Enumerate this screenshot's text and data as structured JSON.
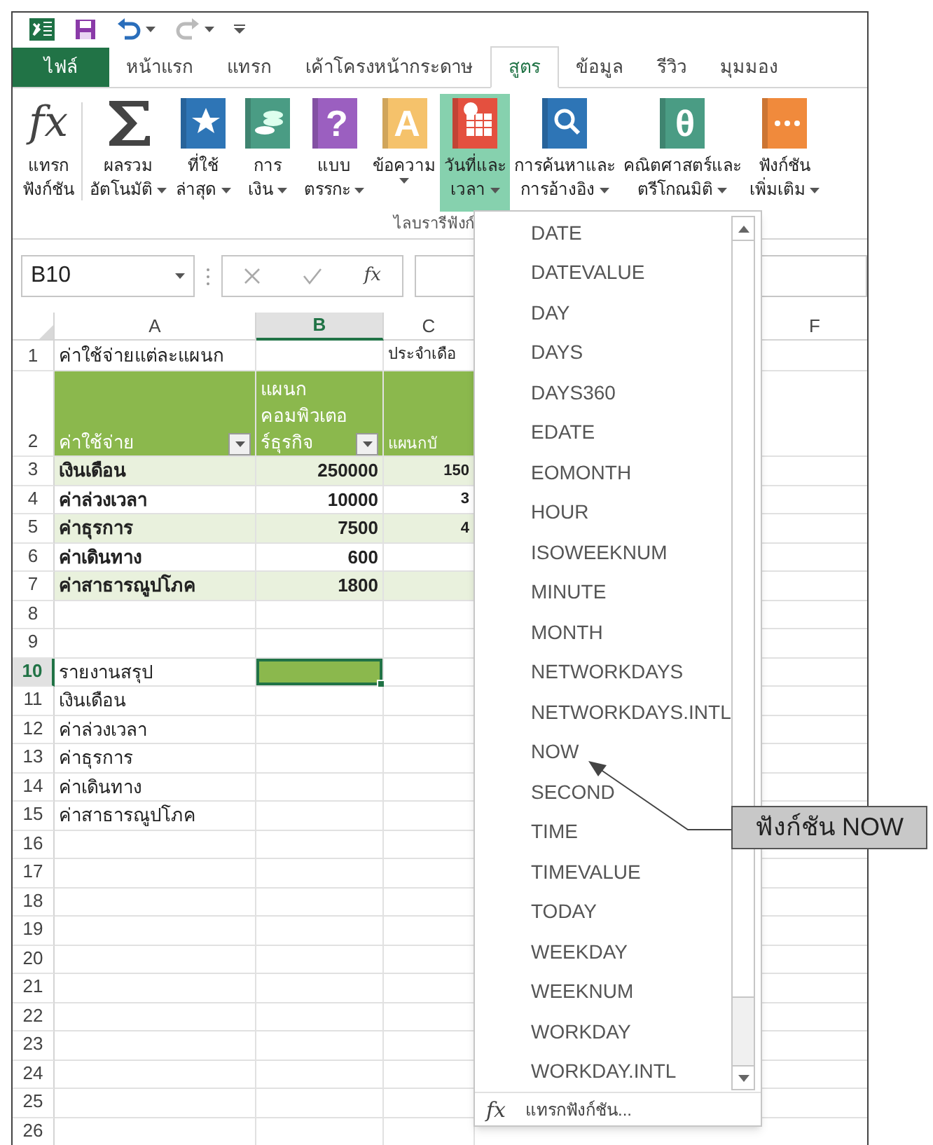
{
  "quick_access": [
    {
      "kind": "excel"
    },
    {
      "kind": "save"
    },
    {
      "kind": "undo"
    },
    {
      "kind": "redo"
    },
    {
      "kind": "customize"
    }
  ],
  "tabs": [
    {
      "label": "ไฟล์",
      "kind": "file",
      "selected": false
    },
    {
      "label": "หน้าแรก",
      "kind": "tab",
      "selected": false
    },
    {
      "label": "แทรก",
      "kind": "tab",
      "selected": false
    },
    {
      "label": "เค้าโครงหน้ากระดาษ",
      "kind": "tab",
      "selected": false
    },
    {
      "label": "สูตร",
      "kind": "tab",
      "selected": true
    },
    {
      "label": "ข้อมูล",
      "kind": "tab",
      "selected": false
    },
    {
      "label": "รีวิว",
      "kind": "tab",
      "selected": false
    },
    {
      "label": "มุมมอง",
      "kind": "tab",
      "selected": false
    }
  ],
  "ribbon": {
    "buttons": [
      {
        "kind": "fx",
        "glyph": "fx",
        "line1": "แทรก",
        "line2": "ฟังก์ชัน",
        "caret": false,
        "selected": false
      },
      {
        "kind": "sum",
        "line1": "ผลรวม",
        "line2": "อัตโนมัติ",
        "caret": true,
        "selected": false
      },
      {
        "kind": "star",
        "color": "#2e75b6",
        "line1": "ที่ใช้",
        "line2": "ล่าสุด",
        "caret": true,
        "selected": false
      },
      {
        "kind": "coins",
        "color": "#4a9c84",
        "line1": "การ",
        "line2": "เงิน",
        "caret": true,
        "selected": false
      },
      {
        "kind": "glyph",
        "glyph": "?",
        "color": "#9b5fc0",
        "line1": "แบบ",
        "line2": "ตรรกะ",
        "caret": true,
        "selected": false
      },
      {
        "kind": "glyph",
        "glyph": "A",
        "color": "#f5c26b",
        "line1": "ข้อความ",
        "caret": true,
        "selected": false
      },
      {
        "kind": "calendar",
        "color": "#e4503f",
        "line1": "วันที่และ",
        "line2": "เวลา",
        "caret": true,
        "selected": true
      },
      {
        "kind": "search",
        "color": "#2e75b6",
        "line1": "การค้นหาและ",
        "line2": "การอ้างอิง",
        "caret": true,
        "selected": false
      },
      {
        "kind": "glyph",
        "glyph": "θ",
        "color": "#4a9c84",
        "line1": "คณิตศาสตร์และ",
        "line2": "ตรีโกณมิติ",
        "caret": true,
        "selected": false
      },
      {
        "kind": "more",
        "color": "#f08a3c",
        "line1": "ฟังก์ชัน",
        "line2": "เพิ่มเติม",
        "caret": true,
        "selected": false
      }
    ],
    "group_label": "ไลบรารีฟังก์"
  },
  "formula_bar": {
    "name_box": "B10",
    "fx": "fx"
  },
  "columns": [
    {
      "label": "A",
      "selected": false
    },
    {
      "label": "B",
      "selected": true
    },
    {
      "label": "C",
      "selected": false
    },
    {
      "label": "F",
      "selected": false
    }
  ],
  "rows": [
    {
      "number": "1",
      "kind": "title",
      "selected": false,
      "cells": [
        {
          "text": "ค่าใช้จ่ายแต่ละแผนก"
        },
        {},
        {
          "text": "ประจำเดือ"
        }
      ]
    },
    {
      "number": "2",
      "kind": "header",
      "selected": false,
      "cells": [
        {
          "text": "ค่าใช้จ่าย",
          "filter": true
        },
        {
          "text": "แผนก\nคอมพิวเตอ\nร์ธุรกิจ",
          "filter": true
        },
        {
          "text": "แผนกบั"
        }
      ]
    },
    {
      "number": "3",
      "kind": "band",
      "selected": false,
      "cells": [
        {
          "text": "เงินเดือน"
        },
        {
          "text": "250000"
        },
        {
          "text": "150"
        }
      ]
    },
    {
      "number": "4",
      "kind": "data",
      "selected": false,
      "cells": [
        {
          "text": "ค่าล่วงเวลา"
        },
        {
          "text": "10000"
        },
        {
          "text": "3"
        }
      ]
    },
    {
      "number": "5",
      "kind": "band",
      "selected": false,
      "cells": [
        {
          "text": "ค่าธุรการ"
        },
        {
          "text": "7500"
        },
        {
          "text": "4"
        }
      ]
    },
    {
      "number": "6",
      "kind": "data",
      "selected": false,
      "cells": [
        {
          "text": "ค่าเดินทาง"
        },
        {
          "text": "600"
        },
        {}
      ]
    },
    {
      "number": "7",
      "kind": "band",
      "selected": false,
      "cells": [
        {
          "text": "ค่าสาธารณูปโภค"
        },
        {
          "text": "1800"
        },
        {}
      ]
    },
    {
      "number": "8",
      "kind": "plain",
      "selected": false,
      "cells": [
        {},
        {},
        {}
      ]
    },
    {
      "number": "9",
      "kind": "plain",
      "selected": false,
      "cells": [
        {},
        {},
        {}
      ]
    },
    {
      "number": "10",
      "kind": "plain",
      "selected": true,
      "cells": [
        {
          "text": "รายงานสรุป"
        },
        {},
        {}
      ]
    },
    {
      "number": "11",
      "kind": "plain",
      "selected": false,
      "cells": [
        {
          "text": "เงินเดือน"
        },
        {},
        {}
      ]
    },
    {
      "number": "12",
      "kind": "plain",
      "selected": false,
      "cells": [
        {
          "text": "ค่าล่วงเวลา"
        },
        {},
        {}
      ]
    },
    {
      "number": "13",
      "kind": "plain",
      "selected": false,
      "cells": [
        {
          "text": "ค่าธุรการ"
        },
        {},
        {}
      ]
    },
    {
      "number": "14",
      "kind": "plain",
      "selected": false,
      "cells": [
        {
          "text": "ค่าเดินทาง"
        },
        {},
        {}
      ]
    },
    {
      "number": "15",
      "kind": "plain",
      "selected": false,
      "cells": [
        {
          "text": "ค่าสาธารณูปโภค"
        },
        {},
        {}
      ]
    },
    {
      "number": "16",
      "kind": "plain",
      "selected": false,
      "cells": [
        {},
        {},
        {}
      ]
    },
    {
      "number": "17",
      "kind": "plain",
      "selected": false,
      "cells": [
        {},
        {},
        {}
      ]
    },
    {
      "number": "18",
      "kind": "plain",
      "selected": false,
      "cells": [
        {},
        {},
        {}
      ]
    },
    {
      "number": "19",
      "kind": "plain",
      "selected": false,
      "cells": [
        {},
        {},
        {}
      ]
    },
    {
      "number": "20",
      "kind": "plain",
      "selected": false,
      "cells": [
        {},
        {},
        {}
      ]
    },
    {
      "number": "21",
      "kind": "plain",
      "selected": false,
      "cells": [
        {},
        {},
        {}
      ]
    },
    {
      "number": "22",
      "kind": "plain",
      "selected": false,
      "cells": [
        {},
        {},
        {}
      ]
    },
    {
      "number": "23",
      "kind": "plain",
      "selected": false,
      "cells": [
        {},
        {},
        {}
      ]
    },
    {
      "number": "24",
      "kind": "plain",
      "selected": false,
      "cells": [
        {},
        {},
        {}
      ]
    },
    {
      "number": "25",
      "kind": "plain",
      "selected": false,
      "cells": [
        {},
        {},
        {}
      ]
    },
    {
      "number": "26",
      "kind": "plain",
      "selected": false,
      "cells": [
        {},
        {},
        {}
      ]
    }
  ],
  "function_menu": {
    "items": [
      "DATE",
      "DATEVALUE",
      "DAY",
      "DAYS",
      "DAYS360",
      "EDATE",
      "EOMONTH",
      "HOUR",
      "ISOWEEKNUM",
      "MINUTE",
      "MONTH",
      "NETWORKDAYS",
      "NETWORKDAYS.INTL",
      "NOW",
      "SECOND",
      "TIME",
      "TIMEVALUE",
      "TODAY",
      "WEEKDAY",
      "WEEKNUM",
      "WORKDAY",
      "WORKDAY.INTL"
    ],
    "footer_icon": "fx",
    "footer": "แทรกฟังก์ชัน..."
  },
  "callout": {
    "text": "ฟังก์ชัน NOW"
  }
}
